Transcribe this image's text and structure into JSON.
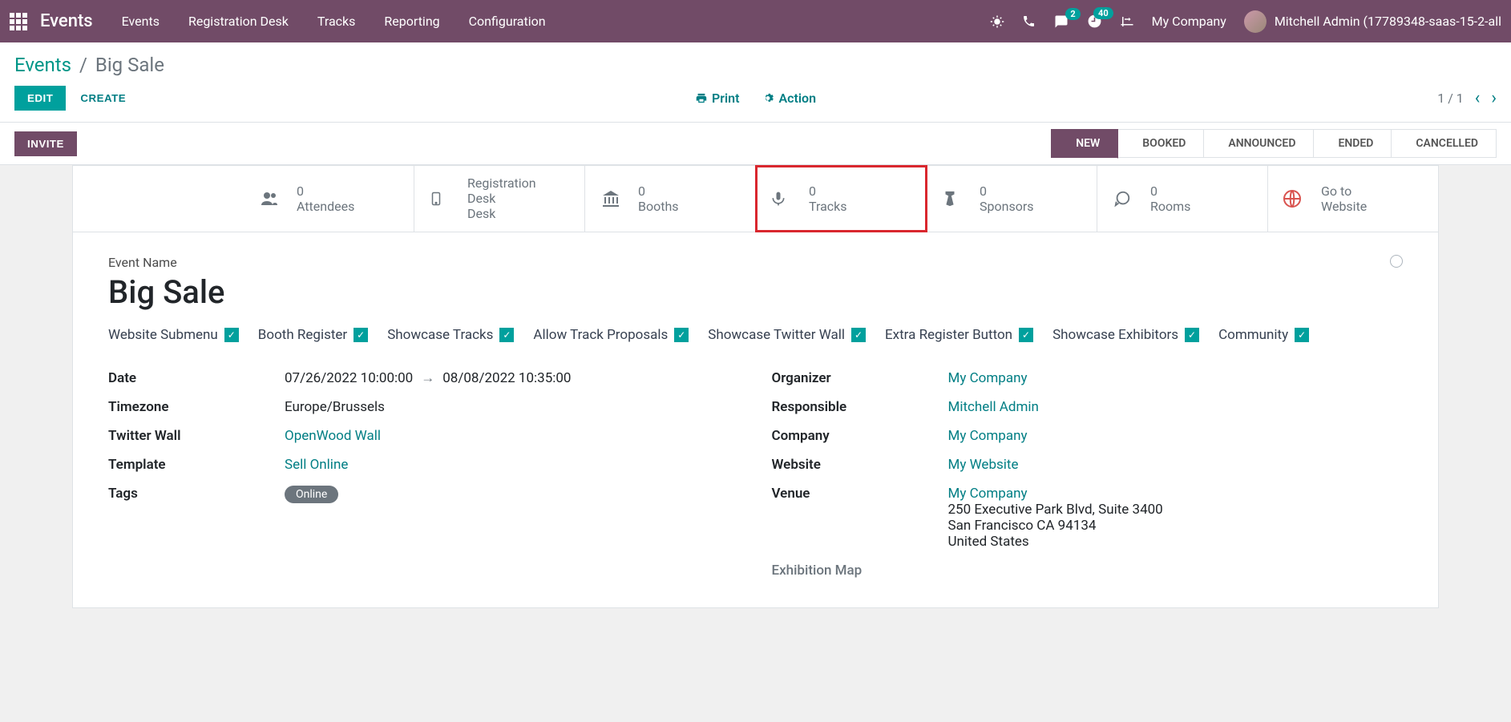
{
  "topnav": {
    "brand": "Events",
    "menu": [
      "Events",
      "Registration Desk",
      "Tracks",
      "Reporting",
      "Configuration"
    ],
    "chat_badge": "2",
    "activity_badge": "40",
    "company": "My Company",
    "user": "Mitchell Admin (17789348-saas-15-2-all"
  },
  "breadcrumb": {
    "root": "Events",
    "current": "Big Sale"
  },
  "toolbar": {
    "edit": "EDIT",
    "create": "CREATE",
    "print": "Print",
    "action": "Action",
    "pager": "1 / 1"
  },
  "statusbar": {
    "invite": "INVITE",
    "stages": [
      "NEW",
      "BOOKED",
      "ANNOUNCED",
      "ENDED",
      "CANCELLED"
    ],
    "active_index": 0
  },
  "stat_buttons": [
    {
      "count": "0",
      "label": "Attendees",
      "icon": "attendees"
    },
    {
      "count": "",
      "label": "Registration Desk",
      "icon": "desk"
    },
    {
      "count": "0",
      "label": "Booths",
      "icon": "booths"
    },
    {
      "count": "0",
      "label": "Tracks",
      "icon": "tracks"
    },
    {
      "count": "0",
      "label": "Sponsors",
      "icon": "sponsors"
    },
    {
      "count": "0",
      "label": "Rooms",
      "icon": "rooms"
    },
    {
      "count": "",
      "label": "Go to Website",
      "icon": "website"
    }
  ],
  "form": {
    "name_label": "Event Name",
    "name": "Big Sale",
    "checkboxes": [
      "Website Submenu",
      "Booth Register",
      "Showcase Tracks",
      "Allow Track Proposals",
      "Showcase Twitter Wall",
      "Extra Register Button",
      "Showcase Exhibitors",
      "Community"
    ],
    "left": {
      "date_label": "Date",
      "date_from": "07/26/2022 10:00:00",
      "date_to": "08/08/2022 10:35:00",
      "tz_label": "Timezone",
      "tz": "Europe/Brussels",
      "twitter_label": "Twitter Wall",
      "twitter": "OpenWood Wall",
      "template_label": "Template",
      "template": "Sell Online",
      "tags_label": "Tags",
      "tag": "Online"
    },
    "right": {
      "organizer_label": "Organizer",
      "organizer": "My Company",
      "responsible_label": "Responsible",
      "responsible": "Mitchell Admin",
      "company_label": "Company",
      "company": "My Company",
      "website_label": "Website",
      "website": "My Website",
      "venue_label": "Venue",
      "venue_name": "My Company",
      "venue_l1": "250 Executive Park Blvd, Suite 3400",
      "venue_l2": "San Francisco CA 94134",
      "venue_l3": "United States",
      "map_label": "Exhibition Map"
    }
  }
}
